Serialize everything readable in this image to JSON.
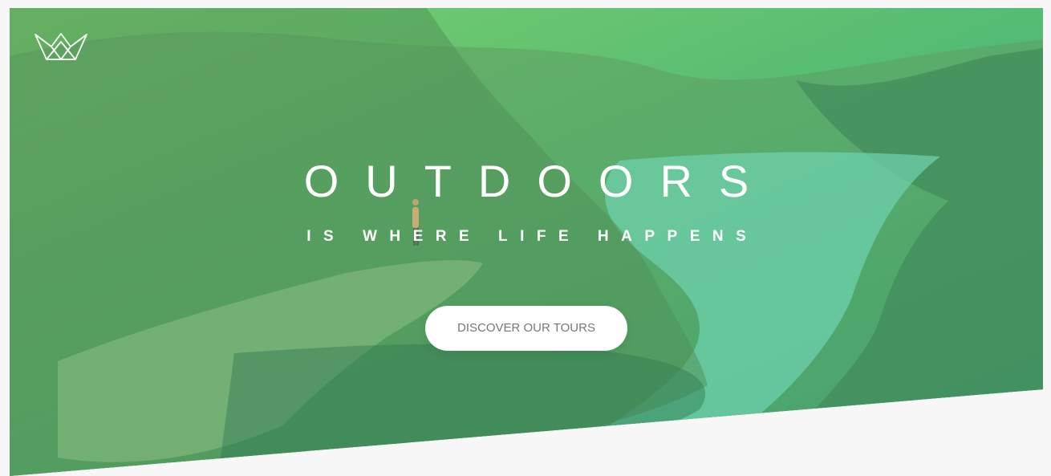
{
  "hero": {
    "heading_main": "OUTDOORS",
    "heading_sub": "IS WHERE LIFE HAPPENS",
    "cta_label": "DISCOVER OUR TOURS"
  },
  "logo": {
    "icon": "crown-icon"
  },
  "colors": {
    "gradient_light": "#7ed56f",
    "gradient_dark": "#28b485",
    "page_background": "#f7f7f7",
    "button_background": "#ffffff",
    "button_text": "#777777",
    "heading_text": "#ffffff"
  }
}
